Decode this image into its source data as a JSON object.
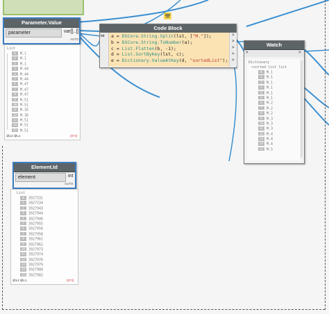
{
  "parameter_node": {
    "title": "Parameter.Value",
    "input_label": "parameter",
    "output_label": "var[]..[]",
    "auto_label": "AUTO",
    "preview_header": "List",
    "items": [
      {
        "index": "0",
        "value": "M.1"
      },
      {
        "index": "1",
        "value": "M.1"
      },
      {
        "index": "2",
        "value": "M.1"
      },
      {
        "index": "3",
        "value": "M.44"
      },
      {
        "index": "4",
        "value": "M.44"
      },
      {
        "index": "5",
        "value": "M.44"
      },
      {
        "index": "6",
        "value": "M.47"
      },
      {
        "index": "7",
        "value": "M.47"
      },
      {
        "index": "8",
        "value": "M.47"
      },
      {
        "index": "9",
        "value": "M.51"
      },
      {
        "index": "10",
        "value": "M.51"
      },
      {
        "index": "11",
        "value": "M.35"
      },
      {
        "index": "12",
        "value": "M.36"
      },
      {
        "index": "13",
        "value": "M.51"
      },
      {
        "index": "14",
        "value": "M.51"
      },
      {
        "index": "15",
        "value": "M.51"
      }
    ],
    "footer_left": "@L2 @L1",
    "footer_right": "{874}"
  },
  "code_block": {
    "title": "Code Block",
    "input_label": "lst",
    "lines": [
      {
        "var": "a",
        "fn": "DSCore.String.Split",
        "args_pre": "(lst, [",
        "str": "\"M.\"",
        "args_post": "]);"
      },
      {
        "var": "b",
        "fn": "DSCore.String.ToNumber",
        "args_pre": "(a);",
        "str": "",
        "args_post": ""
      },
      {
        "var": "c",
        "fn": "List.Flatten",
        "args_pre": "(b, -1);",
        "str": "",
        "args_post": ""
      },
      {
        "var": "d",
        "fn": "List.SortByKey",
        "args_pre": "(lst, c);",
        "str": "",
        "args_post": ""
      },
      {
        "var": "e",
        "fn": "Dictionary.ValueAtKey",
        "args_pre": "(d, ",
        "str": "\"sortedList\"",
        "args_post": ");"
      }
    ],
    "output_arrow": ">"
  },
  "watch_node": {
    "title": "Watch",
    "input_arrow": ">",
    "output_arrow": ">",
    "dict_label": "Dictionary",
    "key_label": "sorted list list",
    "items": [
      {
        "index": "0",
        "value": "M.1"
      },
      {
        "index": "1",
        "value": "M.1"
      },
      {
        "index": "2",
        "value": "M.1"
      },
      {
        "index": "3",
        "value": "M.1"
      },
      {
        "index": "4",
        "value": "M.1"
      },
      {
        "index": "5",
        "value": "M.1"
      },
      {
        "index": "6",
        "value": "M.2"
      },
      {
        "index": "7",
        "value": "M.2"
      },
      {
        "index": "8",
        "value": "M.2"
      },
      {
        "index": "9",
        "value": "M.3"
      },
      {
        "index": "10",
        "value": "M.3"
      },
      {
        "index": "11",
        "value": "M.3"
      },
      {
        "index": "12",
        "value": "M.4"
      },
      {
        "index": "13",
        "value": "M.4"
      },
      {
        "index": "14",
        "value": "M.4"
      },
      {
        "index": "15",
        "value": "M.5"
      }
    ]
  },
  "element_node": {
    "title": "Element.Id",
    "input_label": "element",
    "output_label": "int",
    "auto_label": "AUTO",
    "preview_header": "List",
    "items": [
      {
        "index": "0",
        "value": "3927331"
      },
      {
        "index": "1",
        "value": "3927334"
      },
      {
        "index": "2",
        "value": "3927943"
      },
      {
        "index": "3",
        "value": "3927944"
      },
      {
        "index": "4",
        "value": "3927946"
      },
      {
        "index": "5",
        "value": "3927955"
      },
      {
        "index": "6",
        "value": "3927956"
      },
      {
        "index": "7",
        "value": "3927958"
      },
      {
        "index": "8",
        "value": "3927961"
      },
      {
        "index": "9",
        "value": "3927962"
      },
      {
        "index": "10",
        "value": "3927973"
      },
      {
        "index": "11",
        "value": "3927974"
      },
      {
        "index": "12",
        "value": "3927976"
      },
      {
        "index": "13",
        "value": "3927979"
      },
      {
        "index": "14",
        "value": "3927980"
      },
      {
        "index": "15",
        "value": "3927982"
      }
    ],
    "footer_left": "@L2 @L1",
    "footer_right": "{874}"
  },
  "colors": {
    "wire": "#3a8fd1",
    "header": "#5d6468",
    "code_bg": "#fbe3b3",
    "selection": "#3a7cc0",
    "keyword": "#2a8f88",
    "string": "#b33333"
  }
}
